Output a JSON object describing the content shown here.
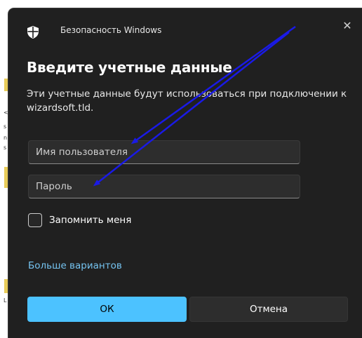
{
  "window": {
    "app_title": "Безопасность Windows",
    "close_glyph": "✕"
  },
  "dialog": {
    "heading": "Введите учетные данные",
    "description": "Эти учетные данные будут использоваться при подключении к wizardsoft.tld."
  },
  "form": {
    "username_placeholder": "Имя пользователя",
    "username_value": "",
    "password_placeholder": "Пароль",
    "password_value": "",
    "remember_label": "Запомнить меня",
    "remember_checked": false
  },
  "links": {
    "more_options": "Больше вариантов"
  },
  "buttons": {
    "ok_label": "ОК",
    "cancel_label": "Отмена"
  },
  "icons": {
    "app": "shield-icon",
    "close": "close-icon",
    "checkbox": "checkbox-unchecked"
  },
  "colors": {
    "dialog_bg": "#202020",
    "accent": "#4cc2ff",
    "link": "#75c3f0",
    "annotation": "#1a1ae6"
  }
}
